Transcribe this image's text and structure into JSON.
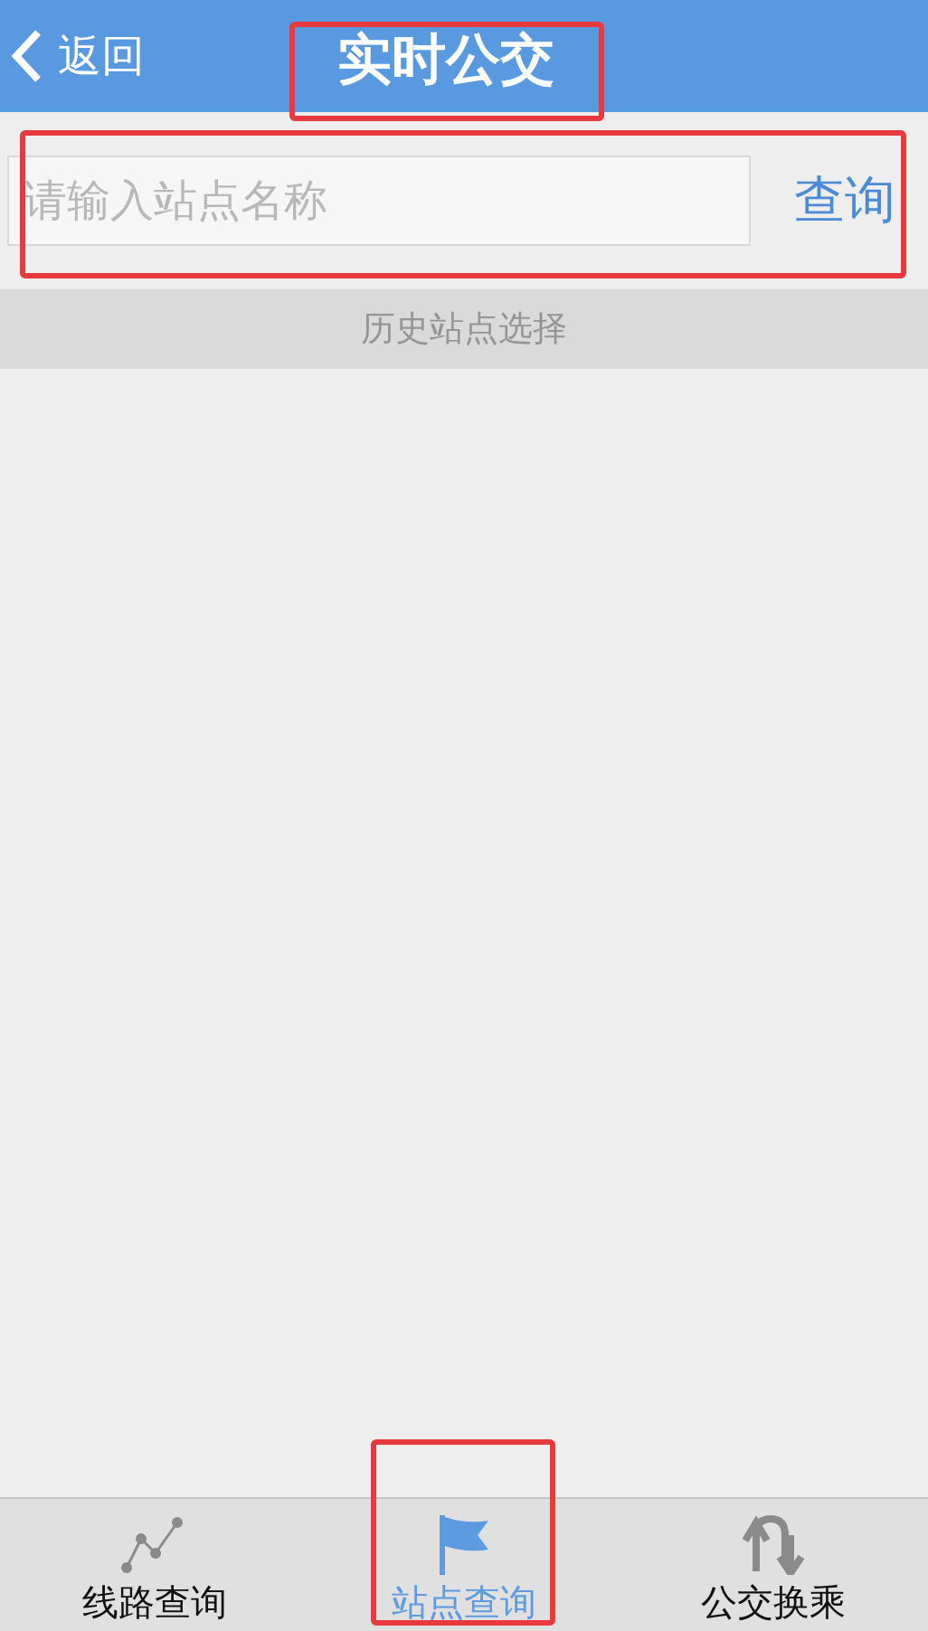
{
  "header": {
    "back": "返回",
    "title": "实时公交"
  },
  "search": {
    "placeholder": "请输入站点名称",
    "button": "查询"
  },
  "history": {
    "label": "历史站点选择"
  },
  "tabs": [
    {
      "label": "线路查询",
      "selected": false
    },
    {
      "label": "站点查询",
      "selected": true
    },
    {
      "label": "公交换乘",
      "selected": false
    }
  ]
}
